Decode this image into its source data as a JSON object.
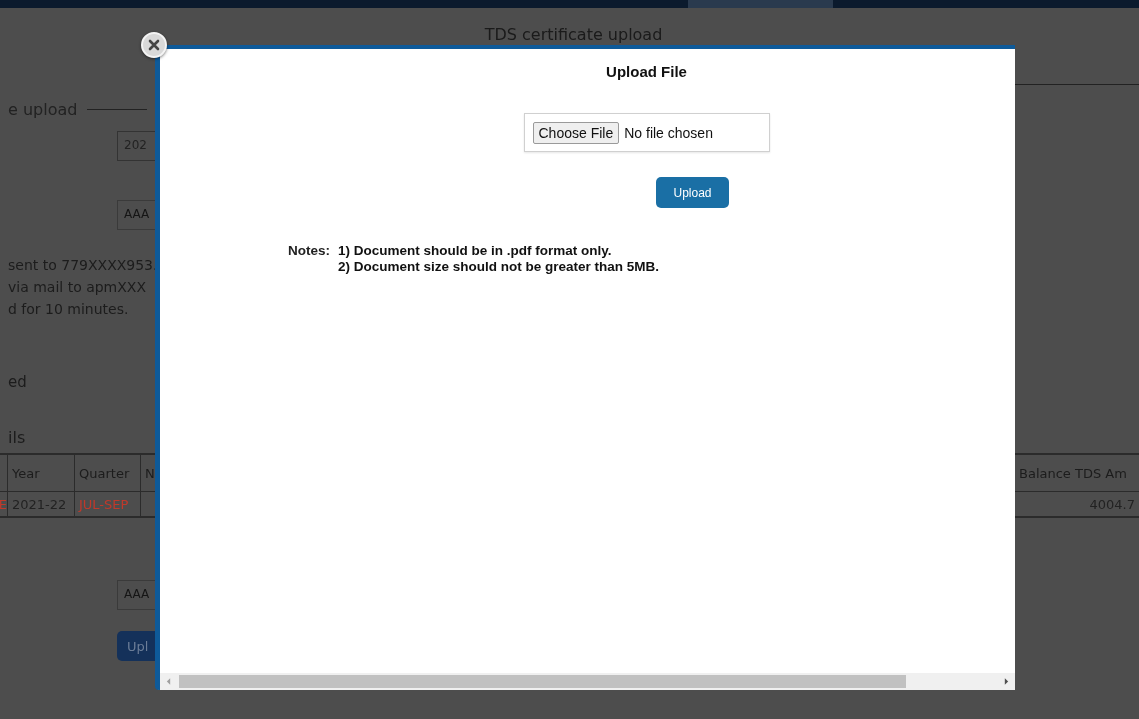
{
  "background": {
    "page_title": "TDS certificate upload",
    "section_legend": "e upload",
    "year_field": {
      "value": "202"
    },
    "pan_field": {
      "placeholder": "AAA"
    },
    "otp_messages": [
      "sent to 779XXXX953.",
      "via mail to apmXXX",
      "d for 10 minutes."
    ],
    "status_text": "ed",
    "details_heading": "ils",
    "table": {
      "left_columns": [
        "Year",
        "Quarter",
        "N"
      ],
      "right_columns": [
        "Balance TDS Am"
      ],
      "left_cells": [
        {
          "text": "E",
          "color": "#c0392b"
        },
        {
          "text": "2021-22",
          "color": "#222222"
        },
        {
          "text": "JUL-SEP",
          "color": "#c0392b"
        }
      ],
      "right_cells": [
        {
          "text": "4004.7",
          "color": "#222222"
        }
      ]
    },
    "pan_field_2": {
      "placeholder": "AAA"
    },
    "upload_button": "Upl"
  },
  "modal": {
    "title": "Upload File",
    "file_input": {
      "button": "Choose File",
      "status": "No file chosen"
    },
    "upload_button": "Upload",
    "notes_label": "Notes:",
    "notes": [
      "1) Document should be in .pdf format only.",
      "2) Document size should not be greater than 5MB."
    ]
  }
}
